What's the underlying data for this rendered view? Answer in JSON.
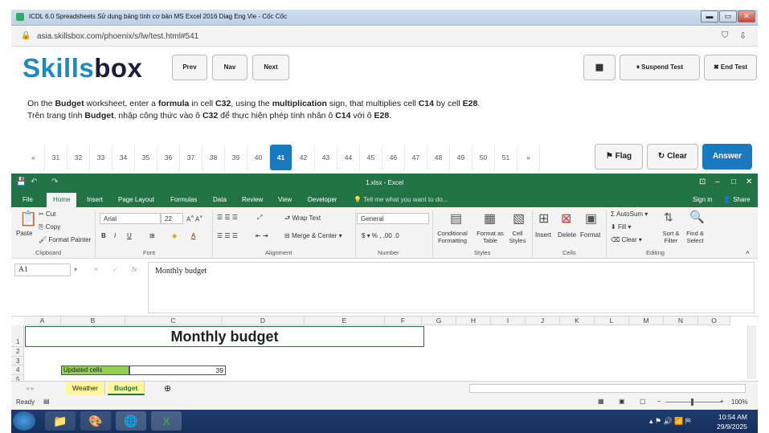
{
  "browser": {
    "tab_title": "ICDL 6.0 Spreadsheets Sử dụng bảng tính cơ bản MS Excel 2016 Diag Eng Vie - Cốc Cốc",
    "url": "asia.skillsbox.com/phoenix/s/lw/test.html#541",
    "min": "▬",
    "max": "▭",
    "close": "✕"
  },
  "skillsbox": {
    "logo_a": "Skills",
    "logo_b": "box",
    "prev": "Prev",
    "nav": "Nav",
    "next": "Next",
    "calc": "▦",
    "suspend": "⏸ Suspend Test",
    "end": "✖ End Test",
    "question_en": "On the <b>Budget</b> worksheet, enter a <b>formula</b> in cell <b>C32</b>, using the <b>multiplication</b> sign, that multiplies cell <b>C14</b> by cell <b>E28</b>.",
    "question_vi": "Trên trang tính <b>Budget</b>, nhập công thức vào ô <b>C32</b> để thực hiện phép tính nhân ô <b>C14</b> với ô <b>E28</b>.",
    "pages": [
      "«",
      "31",
      "32",
      "33",
      "34",
      "35",
      "36",
      "37",
      "38",
      "39",
      "40",
      "41",
      "42",
      "43",
      "44",
      "45",
      "46",
      "47",
      "48",
      "49",
      "50",
      "51",
      "»"
    ],
    "current_page": "41",
    "flag": "⚑ Flag",
    "clear": "↻ Clear",
    "answer": "Answer"
  },
  "excel": {
    "title": "1.xlsx - Excel",
    "tabs": [
      "File",
      "Home",
      "Insert",
      "Page Layout",
      "Formulas",
      "Data",
      "Review",
      "View",
      "Developer"
    ],
    "tell": "Tell me what you want to do...",
    "signin": "Sign in",
    "share": "Share",
    "clipboard": {
      "paste": "Paste",
      "cut": "Cut",
      "copy": "Copy",
      "painter": "Format Painter",
      "label": "Clipboard"
    },
    "font": {
      "name": "Arial",
      "size": "22",
      "label": "Font"
    },
    "alignment": {
      "wrap": "Wrap Text",
      "merge": "Merge & Center",
      "label": "Alignment"
    },
    "number": {
      "format": "General",
      "label": "Number"
    },
    "styles": {
      "cond": "Conditional Formatting",
      "fmt_table": "Format as Table",
      "cell_styles": "Cell Styles",
      "label": "Styles"
    },
    "cells": {
      "insert": "Insert",
      "delete": "Delete",
      "format": "Format",
      "label": "Cells"
    },
    "editing": {
      "autosum": "AutoSum",
      "fill": "Fill",
      "clear": "Clear",
      "sort": "Sort & Filter",
      "find": "Find & Select",
      "label": "Editing"
    },
    "namebox": "A1",
    "formula": "Monthly budget",
    "columns": [
      "A",
      "B",
      "C",
      "D",
      "E",
      "F",
      "G",
      "H",
      "I",
      "J",
      "K",
      "L",
      "M",
      "N",
      "O"
    ],
    "rows": [
      "1",
      "2",
      "3",
      "4",
      "5"
    ],
    "cell_title": "Monthly budget",
    "cell_b4": "Updated cells",
    "cell_c4": "39",
    "sheets": [
      "Weather",
      "Budget"
    ],
    "active_sheet": "Budget",
    "status": "Ready",
    "zoom": "100%"
  },
  "taskbar": {
    "time": "10:54 AM",
    "date": "29/9/2025"
  }
}
